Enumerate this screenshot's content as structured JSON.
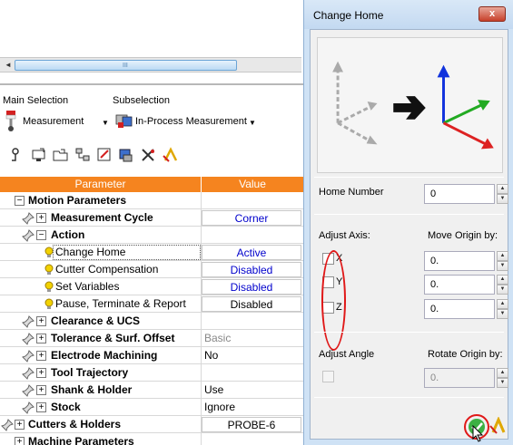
{
  "left_panel": {
    "main_selection_label": "Main Selection",
    "subselection_label": "Subselection",
    "main_selection_value": "Measurement",
    "subselection_value": "In-Process Measurement",
    "dropdown_glyph": "▼",
    "scroll_left_glyph": "◄",
    "scroll_grip": "III",
    "columns": {
      "parameter": "Parameter",
      "value": "Value"
    },
    "rows": [
      {
        "name": "Motion Parameters",
        "value": ""
      },
      {
        "name": "Measurement Cycle",
        "value": "Corner"
      },
      {
        "name": "Action",
        "value": ""
      },
      {
        "name": "Change Home",
        "value": "Active"
      },
      {
        "name": "Cutter Compensation",
        "value": "Disabled"
      },
      {
        "name": "Set Variables",
        "value": "Disabled"
      },
      {
        "name": "Pause, Terminate & Report",
        "value": "Disabled"
      },
      {
        "name": "Clearance & UCS",
        "value": ""
      },
      {
        "name": "Tolerance & Surf. Offset",
        "value": "Basic"
      },
      {
        "name": "Electrode Machining",
        "value": "No"
      },
      {
        "name": "Tool Trajectory",
        "value": ""
      },
      {
        "name": "Shank & Holder",
        "value": "Use"
      },
      {
        "name": "Stock",
        "value": "Ignore"
      },
      {
        "name": "Cutters & Holders",
        "value": "PROBE-6"
      },
      {
        "name": "Machine Parameters",
        "value": ""
      }
    ],
    "expander_minus": "−",
    "expander_plus": "+"
  },
  "dialog": {
    "title": "Change Home",
    "close_glyph": "x",
    "home_number_label": "Home Number",
    "home_number_value": "0",
    "adjust_axis_label": "Adjust Axis:",
    "move_origin_label": "Move Origin by:",
    "axes": [
      {
        "label": "X",
        "value": "0."
      },
      {
        "label": "Y",
        "value": "0."
      },
      {
        "label": "Z",
        "value": "0."
      }
    ],
    "adjust_angle_label": "Adjust Angle",
    "rotate_origin_label": "Rotate Origin by:",
    "rotate_value": "0.",
    "spin_up": "▲",
    "spin_down": "▼"
  },
  "colors": {
    "header_orange": "#f5841f",
    "link_blue": "#0000cc",
    "highlight_red": "#e01818",
    "axis_x": "#dd2222",
    "axis_y": "#22aa22",
    "axis_z": "#1133dd"
  },
  "icons": [
    "probe-icon",
    "in-process-measurement-icon",
    "pin-icon",
    "bulb-icon",
    "arrow-right-icon",
    "ok-checkmark-icon",
    "help-icon",
    "cursor-icon"
  ]
}
